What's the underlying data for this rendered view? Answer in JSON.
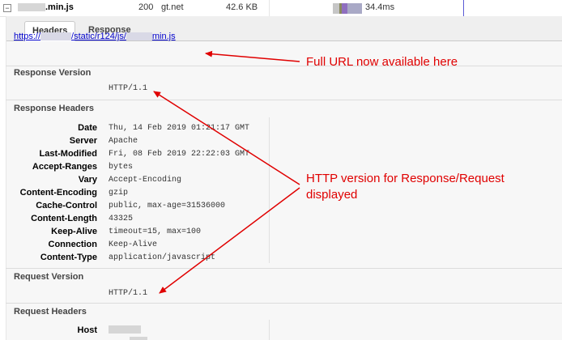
{
  "request": {
    "file_suffix": ".min.js",
    "status": "200",
    "domain": "gt.net",
    "size": "42.6 KB",
    "time": "34.4ms",
    "expand_glyph": "−"
  },
  "tabs": [
    {
      "label": "Headers"
    },
    {
      "label": "Response"
    }
  ],
  "url": {
    "prefix": "https://",
    "middle": "/static/r124/js/",
    "suffix": "min.js"
  },
  "response_version": {
    "title": "Response Version",
    "value": "HTTP/1.1"
  },
  "response_headers": {
    "title": "Response Headers",
    "items": [
      {
        "name": "Date",
        "value": "Thu, 14 Feb 2019 01:21:17 GMT"
      },
      {
        "name": "Server",
        "value": "Apache"
      },
      {
        "name": "Last-Modified",
        "value": "Fri, 08 Feb 2019 22:22:03 GMT"
      },
      {
        "name": "Accept-Ranges",
        "value": "bytes"
      },
      {
        "name": "Vary",
        "value": "Accept-Encoding"
      },
      {
        "name": "Content-Encoding",
        "value": "gzip"
      },
      {
        "name": "Cache-Control",
        "value": "public, max-age=31536000"
      },
      {
        "name": "Content-Length",
        "value": "43325"
      },
      {
        "name": "Keep-Alive",
        "value": "timeout=15, max=100"
      },
      {
        "name": "Connection",
        "value": "Keep-Alive"
      },
      {
        "name": "Content-Type",
        "value": "application/javascript"
      }
    ]
  },
  "request_version": {
    "title": "Request Version",
    "value": "HTTP/1.1"
  },
  "request_headers": {
    "title": "Request Headers",
    "items": [
      {
        "name": "Host",
        "value": ""
      }
    ]
  },
  "annotations": {
    "url_note": "Full URL now available here",
    "version_note_line1": "HTTP version for Response/Request",
    "version_note_line2": "displayed",
    "color": "#e00000"
  }
}
